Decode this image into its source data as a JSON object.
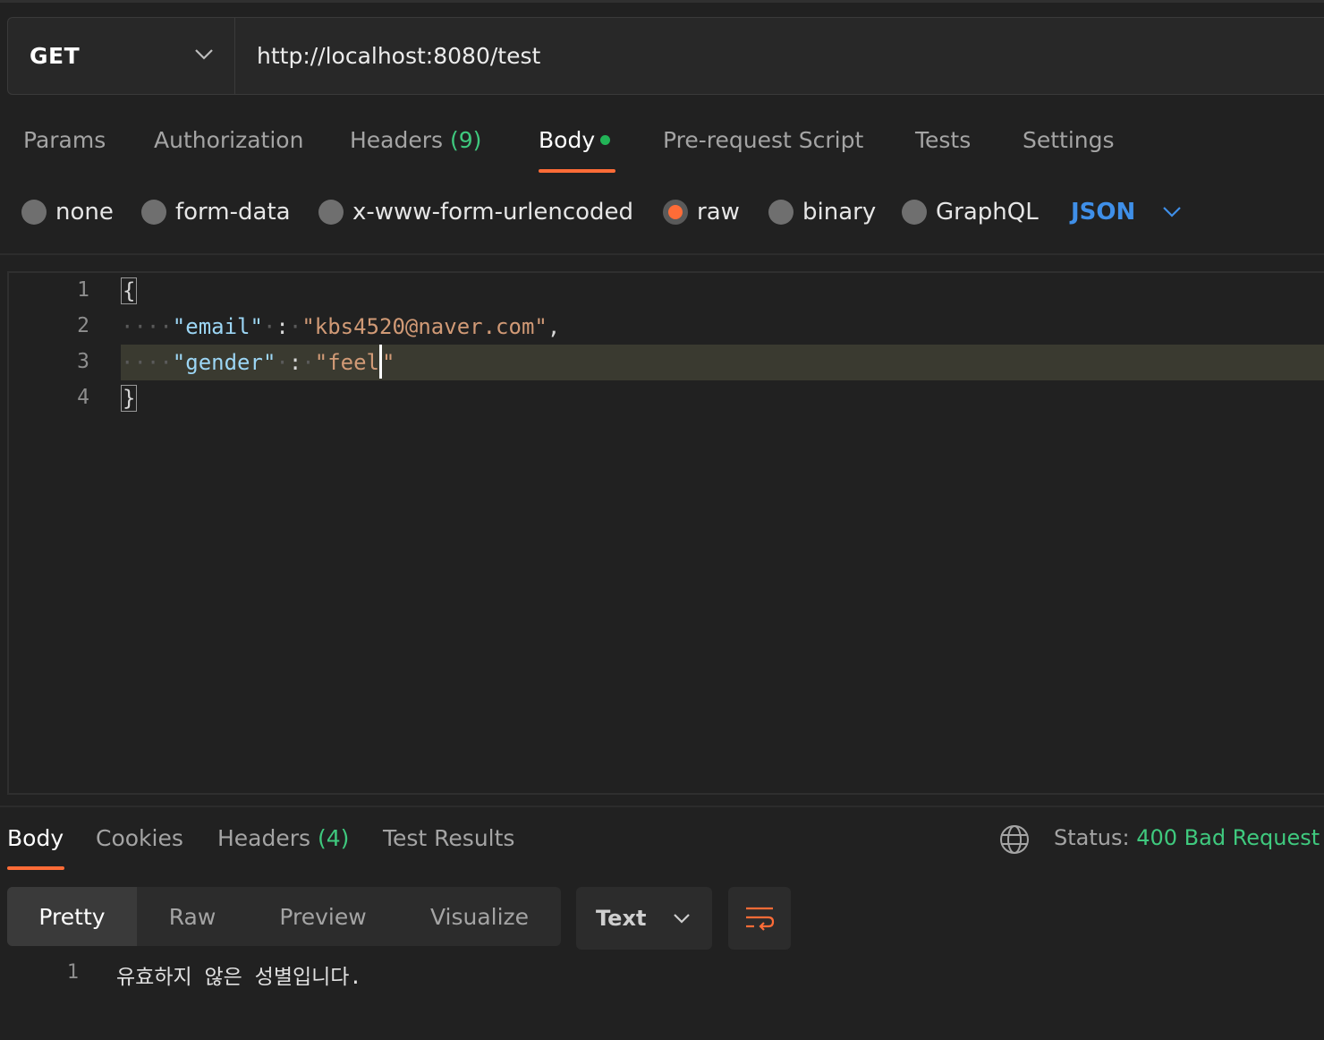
{
  "request": {
    "method": "GET",
    "url": "http://localhost:8080/test"
  },
  "request_tabs": {
    "params": "Params",
    "authorization": "Authorization",
    "headers": "Headers",
    "headers_count": "(9)",
    "body": "Body",
    "prerequest": "Pre-request Script",
    "tests": "Tests",
    "settings": "Settings"
  },
  "body_types": {
    "none": "none",
    "form_data": "form-data",
    "urlencoded": "x-www-form-urlencoded",
    "raw": "raw",
    "binary": "binary",
    "graphql": "GraphQL",
    "format": "JSON",
    "selected": "raw"
  },
  "editor": {
    "line_numbers": [
      "1",
      "2",
      "3",
      "4"
    ],
    "open_brace": "{",
    "close_brace": "}",
    "email_key": "\"email\"",
    "email_value": "\"kbs4520@naver.com\"",
    "gender_key": "\"gender\"",
    "gender_value_open": "\"feel",
    "gender_value_close": "\"",
    "colon": ":",
    "comma": ","
  },
  "response_tabs": {
    "body": "Body",
    "cookies": "Cookies",
    "headers": "Headers",
    "headers_count": "(4)",
    "test_results": "Test Results"
  },
  "status": {
    "label": "Status:",
    "value": "400 Bad Request"
  },
  "view_modes": {
    "pretty": "Pretty",
    "raw": "Raw",
    "preview": "Preview",
    "visualize": "Visualize",
    "format": "Text"
  },
  "response_body": {
    "line_number": "1",
    "text": "유효하지 않은 성별입니다."
  },
  "colors": {
    "accent_orange": "#ff6c37",
    "success_green": "#3fc97e",
    "link_blue": "#3f8fe8",
    "background": "#212121"
  }
}
